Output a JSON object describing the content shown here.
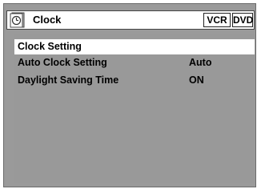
{
  "header": {
    "title": "Clock",
    "icon": "clock-icon",
    "tags": [
      "VCR",
      "DVD"
    ]
  },
  "menu": {
    "items": [
      {
        "label": "Clock Setting",
        "value": "",
        "selected": true
      },
      {
        "label": "Auto Clock Setting",
        "value": "Auto",
        "selected": false
      },
      {
        "label": "Daylight Saving Time",
        "value": "ON",
        "selected": false
      }
    ]
  },
  "colors": {
    "panel_bg": "#999999",
    "highlight": "#ffffff"
  }
}
